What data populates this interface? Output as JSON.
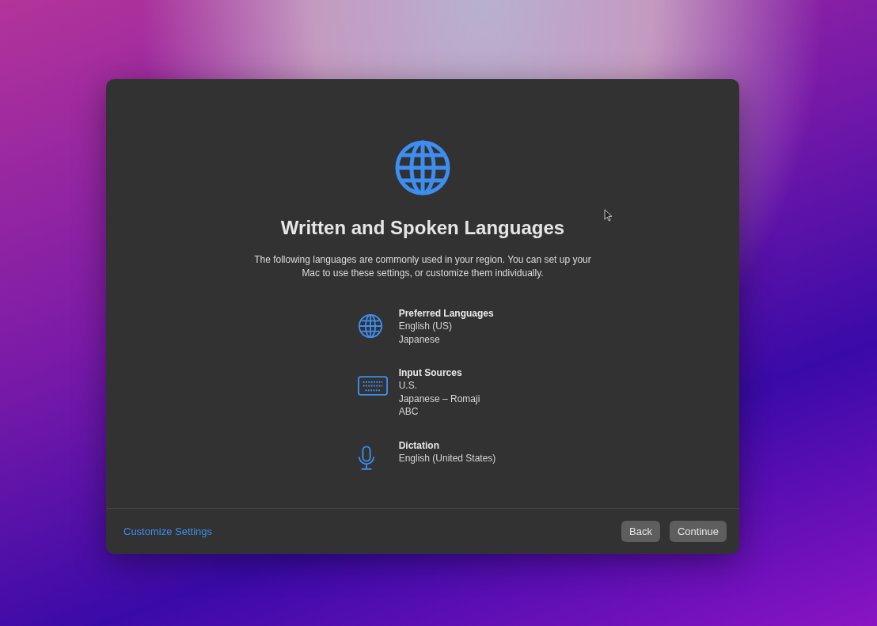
{
  "title": "Written and Spoken Languages",
  "description": "The following languages are commonly used in your region. You can set up your Mac to use these settings, or customize them individually.",
  "sections": [
    {
      "kind": "globe",
      "heading": "Preferred Languages",
      "values": [
        "English (US)",
        "Japanese"
      ]
    },
    {
      "kind": "keyboard",
      "heading": "Input Sources",
      "values": [
        "U.S.",
        "Japanese – Romaji",
        "ABC"
      ]
    },
    {
      "kind": "microphone",
      "heading": "Dictation",
      "values": [
        "English (United States)"
      ]
    }
  ],
  "footer": {
    "link": "Customize Settings",
    "buttons": [
      "Back",
      "Continue"
    ]
  }
}
